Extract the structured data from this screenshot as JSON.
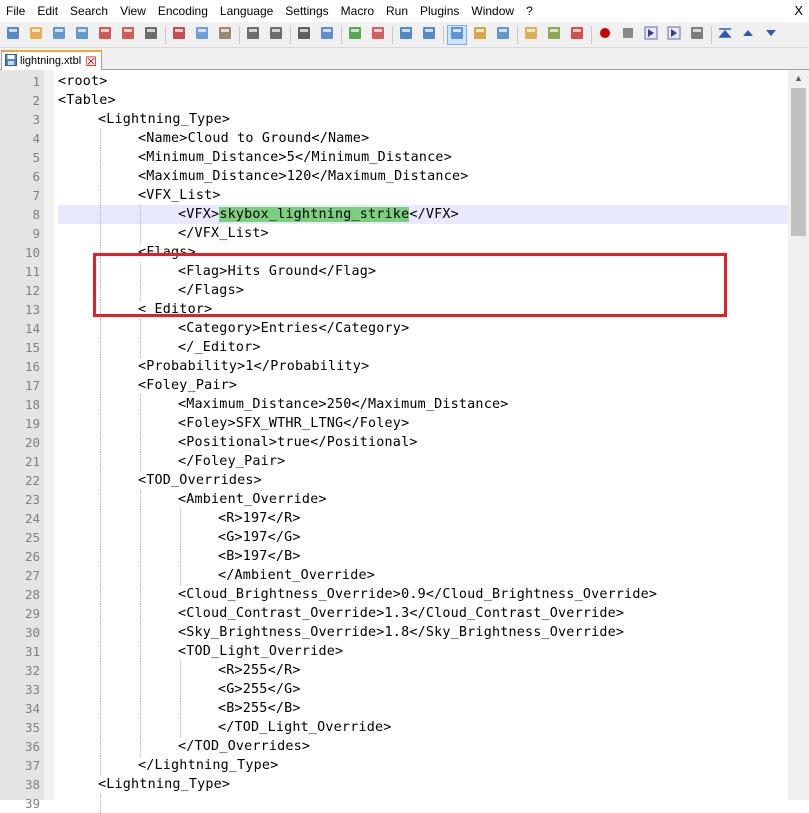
{
  "menu": [
    "File",
    "Edit",
    "Search",
    "View",
    "Encoding",
    "Language",
    "Settings",
    "Macro",
    "Run",
    "Plugins",
    "Window",
    "?"
  ],
  "window_close": "X",
  "toolbar_icons": [
    "new-file-icon",
    "open-file-icon",
    "save-icon",
    "save-all-icon",
    "close-icon",
    "close-all-icon",
    "print-icon",
    "sep",
    "cut-icon",
    "copy-icon",
    "paste-icon",
    "sep",
    "undo-icon",
    "redo-icon",
    "sep",
    "find-icon",
    "replace-icon",
    "sep",
    "zoom-in-icon",
    "zoom-out-icon",
    "sep",
    "sync-vertical-icon",
    "sync-horizontal-icon",
    "sep",
    "word-wrap-icon",
    "show-all-characters-icon",
    "indent-guide-icon",
    "sep",
    "udl-icon",
    "doc-map-icon",
    "function-list-icon",
    "sep",
    "record-macro-icon",
    "stop-macro-icon",
    "play-macro-icon",
    "run-macro-multiple-icon",
    "save-macro-icon",
    "sep",
    "toolbar-extra-1-icon",
    "toolbar-extra-2-icon",
    "toolbar-extra-3-icon"
  ],
  "tab": {
    "label": "lightning.xtbl",
    "close": "☒"
  },
  "editor": {
    "current_line": 8,
    "highlight_text": "skybox_lightning_strike",
    "lines": [
      {
        "n": "1",
        "indent": 0,
        "text": "<root>"
      },
      {
        "n": "2",
        "indent": 0,
        "text": "<Table>"
      },
      {
        "n": "3",
        "indent": 1,
        "text": "<Lightning_Type>"
      },
      {
        "n": "4",
        "indent": 2,
        "text": "<Name>Cloud to Ground</Name>"
      },
      {
        "n": "5",
        "indent": 2,
        "text": "<Minimum_Distance>5</Minimum_Distance>"
      },
      {
        "n": "6",
        "indent": 2,
        "text": "<Maximum_Distance>120</Maximum_Distance>"
      },
      {
        "n": "7",
        "indent": 2,
        "text": "<VFX_List>"
      },
      {
        "n": "8",
        "indent": 3,
        "pre": "<VFX>",
        "hl": "skybox_lightning_strike",
        "post": "</VFX>"
      },
      {
        "n": "9",
        "indent": 3,
        "text": "</VFX_List>"
      },
      {
        "n": "10",
        "indent": 2,
        "text": "<Flags>"
      },
      {
        "n": "11",
        "indent": 3,
        "text": "<Flag>Hits Ground</Flag>"
      },
      {
        "n": "12",
        "indent": 3,
        "text": "</Flags>"
      },
      {
        "n": "13",
        "indent": 2,
        "text": "<_Editor>"
      },
      {
        "n": "14",
        "indent": 3,
        "text": "<Category>Entries</Category>"
      },
      {
        "n": "15",
        "indent": 3,
        "text": "</_Editor>"
      },
      {
        "n": "16",
        "indent": 2,
        "text": "<Probability>1</Probability>"
      },
      {
        "n": "17",
        "indent": 2,
        "text": "<Foley_Pair>"
      },
      {
        "n": "18",
        "indent": 3,
        "text": "<Maximum_Distance>250</Maximum_Distance>"
      },
      {
        "n": "19",
        "indent": 3,
        "text": "<Foley>SFX_WTHR_LTNG</Foley>"
      },
      {
        "n": "20",
        "indent": 3,
        "text": "<Positional>true</Positional>"
      },
      {
        "n": "21",
        "indent": 3,
        "text": "</Foley_Pair>"
      },
      {
        "n": "22",
        "indent": 2,
        "text": "<TOD_Overrides>"
      },
      {
        "n": "23",
        "indent": 3,
        "text": "<Ambient_Override>"
      },
      {
        "n": "24",
        "indent": 4,
        "text": "<R>197</R>"
      },
      {
        "n": "25",
        "indent": 4,
        "text": "<G>197</G>"
      },
      {
        "n": "26",
        "indent": 4,
        "text": "<B>197</B>"
      },
      {
        "n": "27",
        "indent": 4,
        "text": "</Ambient_Override>"
      },
      {
        "n": "28",
        "indent": 3,
        "text": "<Cloud_Brightness_Override>0.9</Cloud_Brightness_Override>"
      },
      {
        "n": "29",
        "indent": 3,
        "text": "<Cloud_Contrast_Override>1.3</Cloud_Contrast_Override>"
      },
      {
        "n": "30",
        "indent": 3,
        "text": "<Sky_Brightness_Override>1.8</Sky_Brightness_Override>"
      },
      {
        "n": "31",
        "indent": 3,
        "text": "<TOD_Light_Override>"
      },
      {
        "n": "32",
        "indent": 4,
        "text": "<R>255</R>"
      },
      {
        "n": "33",
        "indent": 4,
        "text": "<G>255</G>"
      },
      {
        "n": "34",
        "indent": 4,
        "text": "<B>255</B>"
      },
      {
        "n": "35",
        "indent": 4,
        "text": "</TOD_Light_Override>"
      },
      {
        "n": "36",
        "indent": 3,
        "text": "</TOD_Overrides>"
      },
      {
        "n": "37",
        "indent": 2,
        "text": "</Lightning_Type>"
      },
      {
        "n": "38",
        "indent": 1,
        "text": "<Lightning_Type>"
      },
      {
        "n": "39",
        "indent": 2,
        "text": ""
      }
    ]
  },
  "colors": {
    "highlight": "#7ccf7c",
    "current_line": "#e8e8ff",
    "annotation_box": "#e3202a",
    "tab_accent": "#f3a43b"
  }
}
